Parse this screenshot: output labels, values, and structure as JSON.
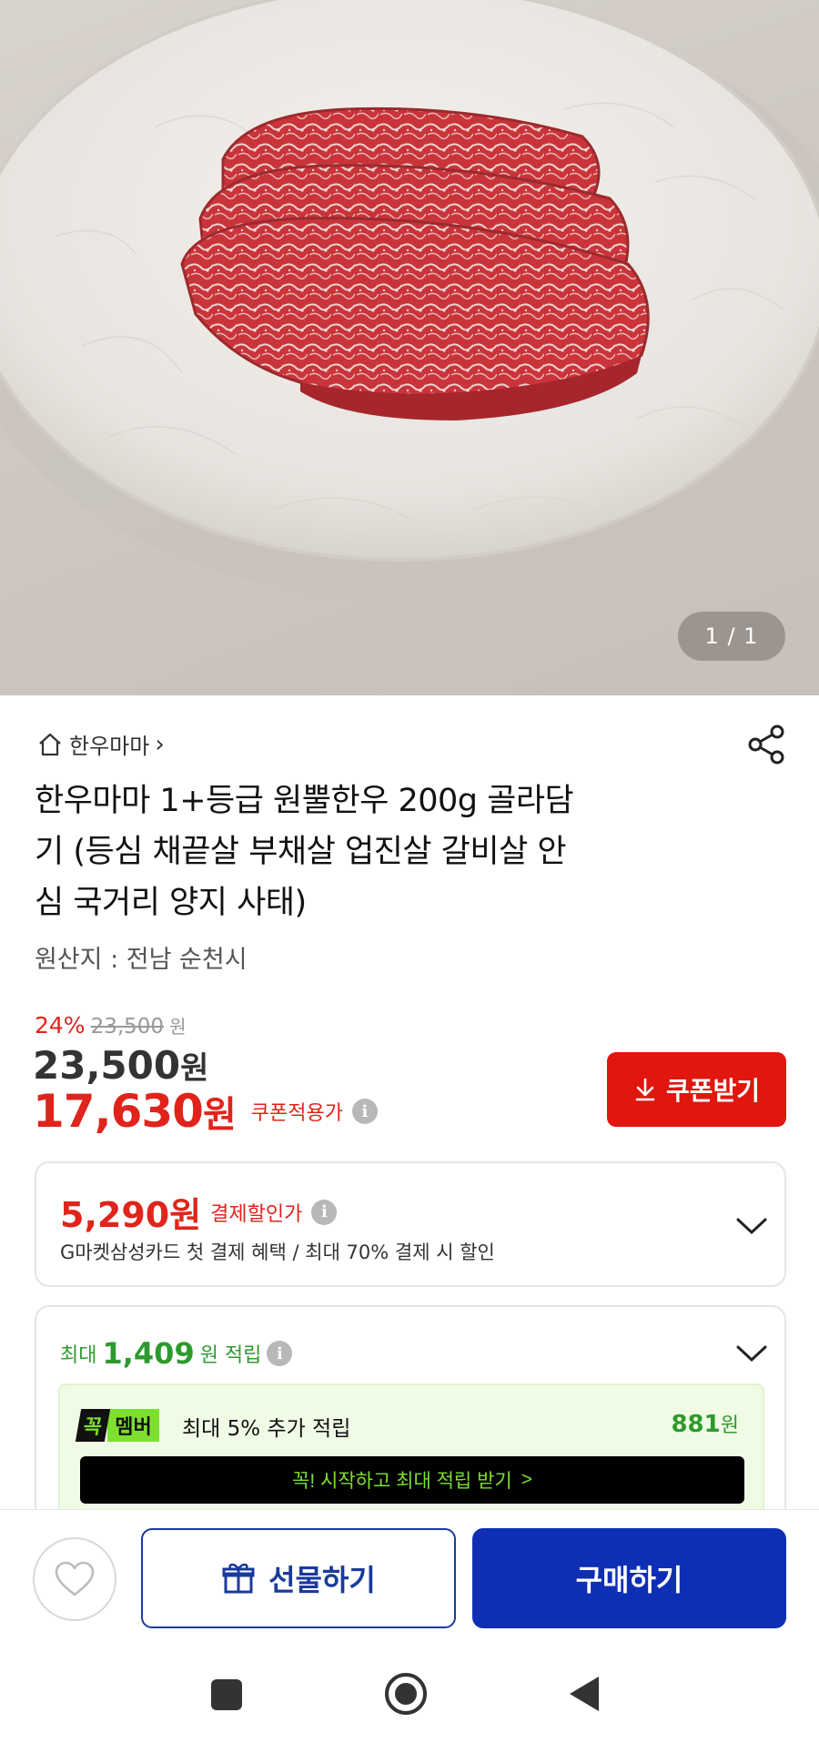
{
  "gallery": {
    "counter": "1 / 1"
  },
  "product": {
    "seller": "한우마마",
    "seller_chevron": "›",
    "title_lines": [
      "한우마마 1+등급 원뿔한우 200g 골라담",
      "기 (등심 채끝살 부채살 업진살 갈비살 안",
      "심 국거리 양지 사태)"
    ],
    "origin": "원산지 : 전남 순천시",
    "discount_pct": "24%",
    "original_price": "23,500",
    "original_price_unit": "원",
    "price": "23,500",
    "price_unit": "원",
    "coupon_price": "17,630",
    "coupon_price_unit": "원",
    "coupon_price_label": "쿠폰적용가",
    "coupon_button": "쿠폰받기"
  },
  "payment_discount": {
    "price": "5,290원",
    "label": "결제할인가",
    "description": "G마켓삼성카드 첫 결제 혜택 / 최대 70% 결제 시 할인"
  },
  "reward": {
    "prefix": "최대",
    "amount": "1,409",
    "suffix": "원 적립",
    "member_badge_k": "꼭",
    "member_badge_m": "멤버",
    "member_text": "최대 5% 추가 적립",
    "member_amount": "881",
    "member_amount_unit": "원",
    "member_cta": "꼭! 시작하고 최대 적립 받기",
    "member_cta_arrow": ">"
  },
  "actions": {
    "gift": "선물하기",
    "buy": "구매하기"
  },
  "icons": {
    "home": "home-outline-icon",
    "share": "share-icon",
    "info": "info-icon",
    "download": "download-arrow-icon",
    "chevron": "chevron-down-icon",
    "heart": "heart-outline-icon",
    "gift": "gift-icon"
  },
  "colors": {
    "discount_red": "#e0241c",
    "coupon_button": "#e0160f",
    "reward_green": "#2e9a2e",
    "member_green": "#7de02f",
    "brand_blue": "#0e2fb5",
    "gift_blue": "#1a3a9c"
  }
}
